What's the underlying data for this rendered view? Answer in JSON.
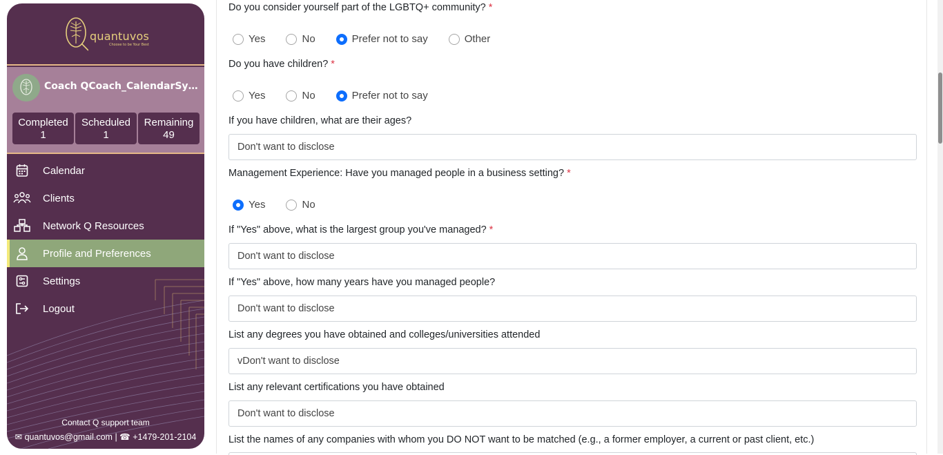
{
  "sidebar": {
    "logo_text": "quantuvos",
    "logo_tagline": "Choose to be Your Best",
    "coach_name": "Coach QCoach_CalendarSync'...",
    "stats": [
      {
        "label": "Completed",
        "value": "1"
      },
      {
        "label": "Scheduled",
        "value": "1"
      },
      {
        "label": "Remaining",
        "value": "49"
      }
    ],
    "nav": [
      {
        "label": "Calendar",
        "icon": "calendar-icon"
      },
      {
        "label": "Clients",
        "icon": "users-icon"
      },
      {
        "label": "Network Q Resources",
        "icon": "network-icon"
      },
      {
        "label": "Profile and Preferences",
        "icon": "user-icon",
        "active": true
      },
      {
        "label": "Settings",
        "icon": "settings-icon"
      },
      {
        "label": "Logout",
        "icon": "logout-icon"
      }
    ],
    "contact_title": "Contact Q support team",
    "contact_email": "quantuvos@gmail.com",
    "contact_phone": "+1479-201-2104",
    "colors": {
      "background": "#552f4e",
      "accent": "#e6cf7d",
      "active": "#8fa77a"
    }
  },
  "form": {
    "q_lgbtq": {
      "label": "Do you consider yourself part of the LGBTQ+ community?",
      "required": "*",
      "options": [
        "Yes",
        "No",
        "Prefer not to say",
        "Other"
      ],
      "selected": "Prefer not to say"
    },
    "q_children": {
      "label": "Do you have children?",
      "required": "*",
      "options": [
        "Yes",
        "No",
        "Prefer not to say"
      ],
      "selected": "Prefer not to say"
    },
    "q_children_ages": {
      "label": "If you have children, what are their ages?",
      "value": "Don't want to disclose"
    },
    "q_management": {
      "label": "Management Experience: Have you managed people in a business setting?",
      "required": "*",
      "options": [
        "Yes",
        "No"
      ],
      "selected": "Yes"
    },
    "q_largest_group": {
      "label": "If \"Yes\" above, what is the largest group you've managed?",
      "required": "*",
      "value": "Don't want to disclose"
    },
    "q_years_managed": {
      "label": "If \"Yes\" above, how many years have you managed people?",
      "value": "Don't want to disclose"
    },
    "q_degrees": {
      "label": "List any degrees you have obtained and colleges/universities attended",
      "value": "vDon't want to disclose"
    },
    "q_certifications": {
      "label": "List any relevant certifications you have obtained",
      "value": "Don't want to disclose"
    },
    "q_companies": {
      "label": "List the names of any companies with whom you DO NOT want to be matched (e.g., a former employer, a current or past client, etc.)"
    }
  }
}
